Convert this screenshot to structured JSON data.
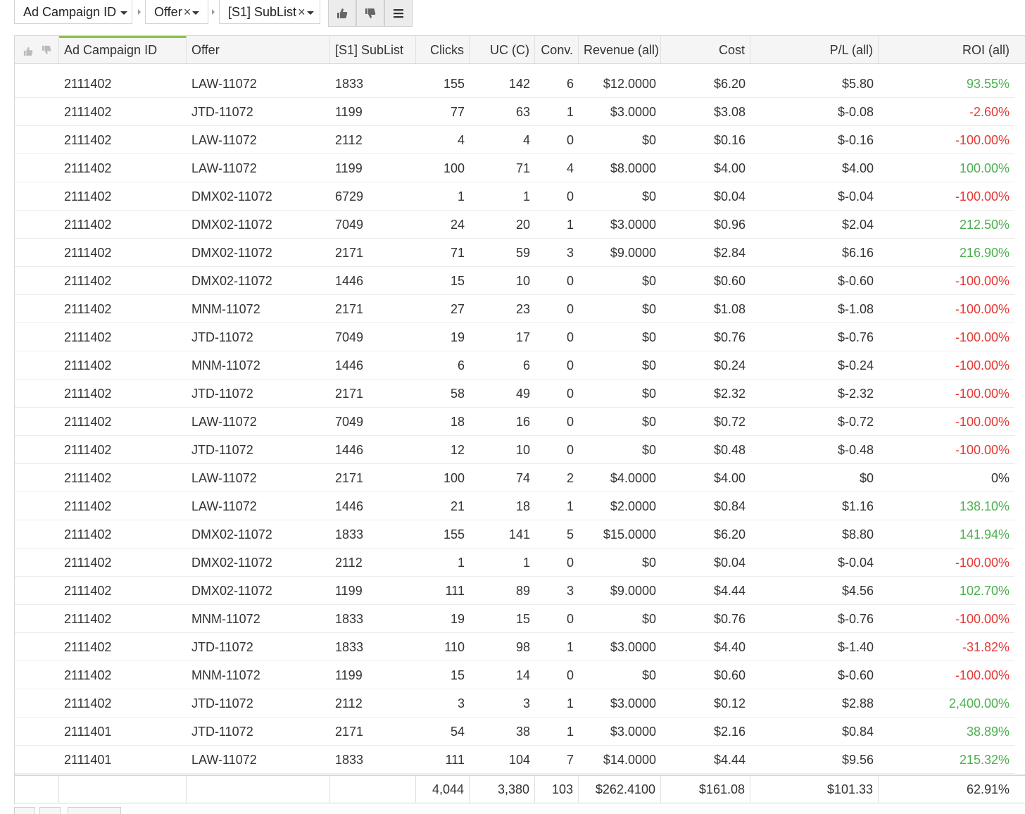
{
  "filters": [
    {
      "label": "Ad Campaign ID",
      "removable": false
    },
    {
      "label": "Offer",
      "removable": true
    },
    {
      "label": "[S1] SubList",
      "removable": true
    }
  ],
  "toolbar_icons": [
    "thumbs-up-icon",
    "thumbs-down-icon",
    "menu-icon"
  ],
  "columns": [
    "Ad Campaign ID",
    "Offer",
    "[S1] SubList",
    "Clicks",
    "UC (C)",
    "Conv.",
    "Revenue (all)",
    "Cost",
    "P/L (all)",
    "ROI (all)"
  ],
  "rows": [
    [
      "2111402",
      "LAW-11072",
      "1833",
      "155",
      "142",
      "6",
      "$12.0000",
      "$6.20",
      "$5.80",
      "93.55%"
    ],
    [
      "2111402",
      "JTD-11072",
      "1199",
      "77",
      "63",
      "1",
      "$3.0000",
      "$3.08",
      "$-0.08",
      "-2.60%"
    ],
    [
      "2111402",
      "LAW-11072",
      "2112",
      "4",
      "4",
      "0",
      "$0",
      "$0.16",
      "$-0.16",
      "-100.00%"
    ],
    [
      "2111402",
      "LAW-11072",
      "1199",
      "100",
      "71",
      "4",
      "$8.0000",
      "$4.00",
      "$4.00",
      "100.00%"
    ],
    [
      "2111402",
      "DMX02-11072",
      "6729",
      "1",
      "1",
      "0",
      "$0",
      "$0.04",
      "$-0.04",
      "-100.00%"
    ],
    [
      "2111402",
      "DMX02-11072",
      "7049",
      "24",
      "20",
      "1",
      "$3.0000",
      "$0.96",
      "$2.04",
      "212.50%"
    ],
    [
      "2111402",
      "DMX02-11072",
      "2171",
      "71",
      "59",
      "3",
      "$9.0000",
      "$2.84",
      "$6.16",
      "216.90%"
    ],
    [
      "2111402",
      "DMX02-11072",
      "1446",
      "15",
      "10",
      "0",
      "$0",
      "$0.60",
      "$-0.60",
      "-100.00%"
    ],
    [
      "2111402",
      "MNM-11072",
      "2171",
      "27",
      "23",
      "0",
      "$0",
      "$1.08",
      "$-1.08",
      "-100.00%"
    ],
    [
      "2111402",
      "JTD-11072",
      "7049",
      "19",
      "17",
      "0",
      "$0",
      "$0.76",
      "$-0.76",
      "-100.00%"
    ],
    [
      "2111402",
      "MNM-11072",
      "1446",
      "6",
      "6",
      "0",
      "$0",
      "$0.24",
      "$-0.24",
      "-100.00%"
    ],
    [
      "2111402",
      "JTD-11072",
      "2171",
      "58",
      "49",
      "0",
      "$0",
      "$2.32",
      "$-2.32",
      "-100.00%"
    ],
    [
      "2111402",
      "LAW-11072",
      "7049",
      "18",
      "16",
      "0",
      "$0",
      "$0.72",
      "$-0.72",
      "-100.00%"
    ],
    [
      "2111402",
      "JTD-11072",
      "1446",
      "12",
      "10",
      "0",
      "$0",
      "$0.48",
      "$-0.48",
      "-100.00%"
    ],
    [
      "2111402",
      "LAW-11072",
      "2171",
      "100",
      "74",
      "2",
      "$4.0000",
      "$4.00",
      "$0",
      "0%"
    ],
    [
      "2111402",
      "LAW-11072",
      "1446",
      "21",
      "18",
      "1",
      "$2.0000",
      "$0.84",
      "$1.16",
      "138.10%"
    ],
    [
      "2111402",
      "DMX02-11072",
      "1833",
      "155",
      "141",
      "5",
      "$15.0000",
      "$6.20",
      "$8.80",
      "141.94%"
    ],
    [
      "2111402",
      "DMX02-11072",
      "2112",
      "1",
      "1",
      "0",
      "$0",
      "$0.04",
      "$-0.04",
      "-100.00%"
    ],
    [
      "2111402",
      "DMX02-11072",
      "1199",
      "111",
      "89",
      "3",
      "$9.0000",
      "$4.44",
      "$4.56",
      "102.70%"
    ],
    [
      "2111402",
      "MNM-11072",
      "1833",
      "19",
      "15",
      "0",
      "$0",
      "$0.76",
      "$-0.76",
      "-100.00%"
    ],
    [
      "2111402",
      "JTD-11072",
      "1833",
      "110",
      "98",
      "1",
      "$3.0000",
      "$4.40",
      "$-1.40",
      "-31.82%"
    ],
    [
      "2111402",
      "MNM-11072",
      "1199",
      "15",
      "14",
      "0",
      "$0",
      "$0.60",
      "$-0.60",
      "-100.00%"
    ],
    [
      "2111402",
      "JTD-11072",
      "2112",
      "3",
      "3",
      "1",
      "$3.0000",
      "$0.12",
      "$2.88",
      "2,400.00%"
    ],
    [
      "2111401",
      "JTD-11072",
      "2171",
      "54",
      "38",
      "1",
      "$3.0000",
      "$2.16",
      "$0.84",
      "38.89%"
    ],
    [
      "2111401",
      "LAW-11072",
      "1833",
      "111",
      "104",
      "7",
      "$14.0000",
      "$4.44",
      "$9.56",
      "215.32%"
    ]
  ],
  "totals": {
    "clicks": "4,044",
    "uc": "3,380",
    "conv": "103",
    "revenue": "$262.4100",
    "cost": "$161.08",
    "pl": "$101.33",
    "roi": "62.91%"
  },
  "colors": {
    "positive": "#4caf50",
    "negative": "#e53935",
    "sort_accent": "#8bc34a"
  }
}
